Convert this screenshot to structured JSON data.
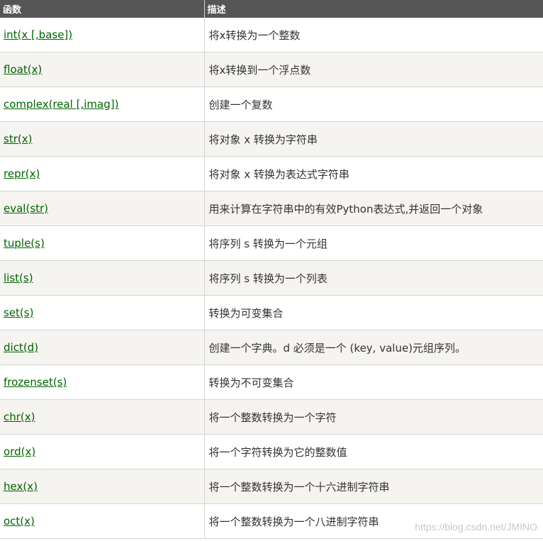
{
  "table": {
    "headers": [
      "函数",
      "描述"
    ],
    "rows": [
      {
        "func": "int(x [,base])",
        "desc": "将x转换为一个整数"
      },
      {
        "func": "float(x)",
        "desc": "将x转换到一个浮点数"
      },
      {
        "func": "complex(real [,imag])",
        "desc": "创建一个复数"
      },
      {
        "func": "str(x)",
        "desc": "将对象 x 转换为字符串"
      },
      {
        "func": "repr(x)",
        "desc": "将对象 x 转换为表达式字符串"
      },
      {
        "func": "eval(str)",
        "desc": "用来计算在字符串中的有效Python表达式,并返回一个对象"
      },
      {
        "func": "tuple(s)",
        "desc": "将序列 s 转换为一个元组"
      },
      {
        "func": "list(s)",
        "desc": "将序列 s 转换为一个列表"
      },
      {
        "func": "set(s)",
        "desc": "转换为可变集合"
      },
      {
        "func": "dict(d)",
        "desc": "创建一个字典。d 必须是一个 (key, value)元组序列。"
      },
      {
        "func": "frozenset(s)",
        "desc": "转换为不可变集合"
      },
      {
        "func": "chr(x)",
        "desc": "将一个整数转换为一个字符"
      },
      {
        "func": "ord(x)",
        "desc": "将一个字符转换为它的整数值"
      },
      {
        "func": "hex(x)",
        "desc": "将一个整数转换为一个十六进制字符串"
      },
      {
        "func": "oct(x)",
        "desc": "将一个整数转换为一个八进制字符串"
      }
    ]
  },
  "watermark": "https://blog.csdn.net/JMINO",
  "colors": {
    "header_bg": "#555555",
    "link": "#006400",
    "row_alt": "#f6f4f0"
  }
}
